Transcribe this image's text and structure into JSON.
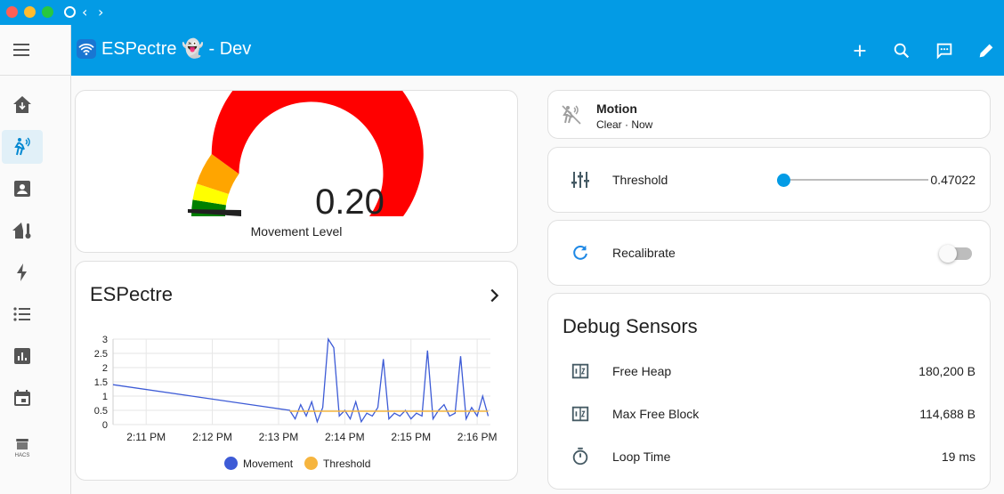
{
  "window": {
    "controls": [
      "close",
      "minimize",
      "maximize"
    ]
  },
  "header": {
    "title": "ESPectre 👻 - Dev",
    "actions": [
      "add-icon",
      "search-icon",
      "assist-icon",
      "edit-icon"
    ]
  },
  "sidebar": {
    "items": [
      {
        "icon": "overview-icon",
        "active": false
      },
      {
        "icon": "motion-icon",
        "active": true
      },
      {
        "icon": "profile-icon",
        "active": false
      },
      {
        "icon": "home-thermometer-icon",
        "active": false
      },
      {
        "icon": "energy-icon",
        "active": false
      },
      {
        "icon": "logbook-icon",
        "active": false
      },
      {
        "icon": "history-icon",
        "active": false
      },
      {
        "icon": "calendar-icon",
        "active": false
      },
      {
        "icon": "hacs-icon",
        "active": false,
        "label": "HACS"
      }
    ]
  },
  "gauge": {
    "value": 0.2,
    "value_text": "0.20",
    "min": 0,
    "max": 1,
    "label": "Movement Level",
    "segments": [
      {
        "from": 0,
        "to": 0.05,
        "color": "#008000"
      },
      {
        "from": 0.05,
        "to": 0.1,
        "color": "#ffff00"
      },
      {
        "from": 0.1,
        "to": 0.2,
        "color": "#ffa500"
      },
      {
        "from": 0.2,
        "to": 1,
        "color": "#ff0000"
      }
    ]
  },
  "history": {
    "title": "ESPectre"
  },
  "chart_data": {
    "type": "line",
    "x_ticks": [
      "2:11 PM",
      "2:12 PM",
      "2:13 PM",
      "2:14 PM",
      "2:15 PM",
      "2:16 PM"
    ],
    "y_ticks": [
      "0",
      "0.5",
      "1",
      "1.5",
      "2",
      "2.5",
      "3"
    ],
    "ylim": [
      0,
      3
    ],
    "grid": true,
    "legend_position": "bottom",
    "series": [
      {
        "name": "Movement",
        "color": "#3d5bd6",
        "x": [
          "2:10:30",
          "2:13:10",
          "2:13:15",
          "2:13:20",
          "2:13:25",
          "2:13:30",
          "2:13:35",
          "2:13:40",
          "2:13:45",
          "2:13:50",
          "2:13:55",
          "2:14:00",
          "2:14:05",
          "2:14:10",
          "2:14:15",
          "2:14:20",
          "2:14:25",
          "2:14:30",
          "2:14:35",
          "2:14:40",
          "2:14:45",
          "2:14:50",
          "2:14:55",
          "2:15:00",
          "2:15:05",
          "2:15:10",
          "2:15:15",
          "2:15:20",
          "2:15:25",
          "2:15:30",
          "2:15:35",
          "2:15:40",
          "2:15:45",
          "2:15:50",
          "2:15:55",
          "2:16:00",
          "2:16:05",
          "2:16:10"
        ],
        "y": [
          1.4,
          0.5,
          0.2,
          0.7,
          0.3,
          0.8,
          0.1,
          0.6,
          3.0,
          2.7,
          0.3,
          0.5,
          0.2,
          0.8,
          0.1,
          0.4,
          0.3,
          0.6,
          2.3,
          0.2,
          0.4,
          0.3,
          0.5,
          0.2,
          0.4,
          0.3,
          2.6,
          0.2,
          0.5,
          0.7,
          0.3,
          0.4,
          2.4,
          0.2,
          0.6,
          0.3,
          1.0,
          0.3
        ]
      },
      {
        "name": "Threshold",
        "color": "#f6b53f",
        "x": [
          "2:13:10",
          "2:16:10"
        ],
        "y": [
          0.47,
          0.47
        ]
      }
    ]
  },
  "motion": {
    "name": "Motion",
    "state": "Clear · Now"
  },
  "threshold": {
    "label": "Threshold",
    "value": 0.47022,
    "value_text": "0.47022",
    "min": 0,
    "max": 10
  },
  "recalibrate": {
    "label": "Recalibrate",
    "on": false
  },
  "debug": {
    "title": "Debug Sensors",
    "rows": [
      {
        "icon": "numeric-icon",
        "label": "Free Heap",
        "value": "180,200 B"
      },
      {
        "icon": "numeric-icon",
        "label": "Max Free Block",
        "value": "114,688 B"
      },
      {
        "icon": "timer-icon",
        "label": "Loop Time",
        "value": "19 ms"
      }
    ]
  }
}
